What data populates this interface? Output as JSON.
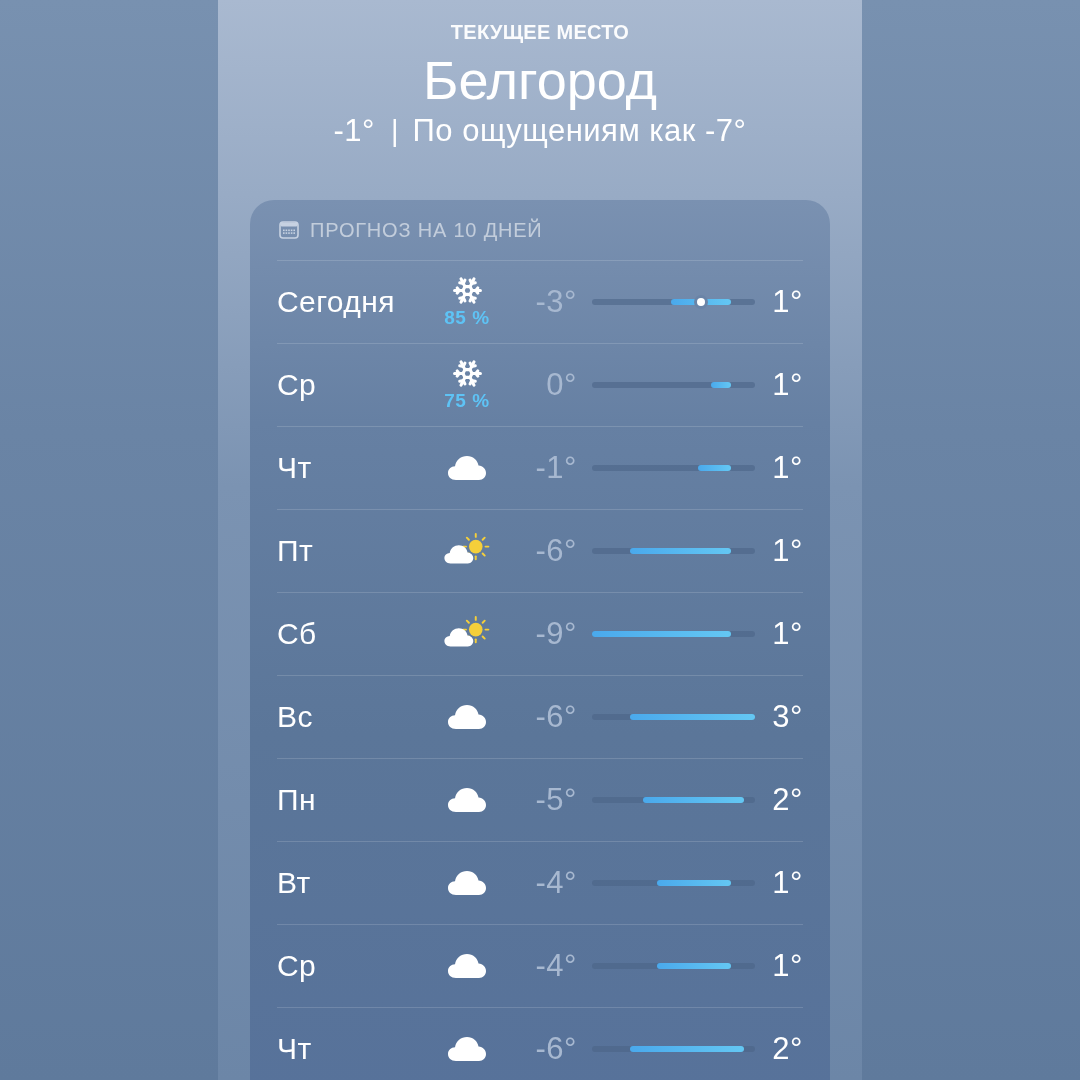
{
  "header": {
    "subtitle": "ТЕКУЩЕЕ МЕСТО",
    "city": "Белгород",
    "temperature": "-1°",
    "separator": "|",
    "feels_like": "По ощущениям как -7°"
  },
  "forecast": {
    "title": "ПРОГНОЗ НА 10 ДНЕЙ",
    "days": [
      {
        "day": "Сегодня",
        "kind": "snow",
        "precipitation": "85 %",
        "low": "-3°",
        "high": "1°",
        "current": {
          "level": 0.67
        }
      },
      {
        "day": "Ср",
        "kind": "snow",
        "precipitation": "75 %",
        "low": "0°",
        "high": "1°"
      },
      {
        "day": "Чт",
        "kind": "cloudy",
        "low": "-1°",
        "high": "1°"
      },
      {
        "day": "Пт",
        "kind": "partly_sunny",
        "low": "-6°",
        "high": "1°"
      },
      {
        "day": "Сб",
        "kind": "partly_sunny",
        "low": "-9°",
        "high": "1°"
      },
      {
        "day": "Вс",
        "kind": "cloudy",
        "low": "-6°",
        "high": "3°"
      },
      {
        "day": "Пн",
        "kind": "cloudy",
        "low": "-5°",
        "high": "2°"
      },
      {
        "day": "Вт",
        "kind": "cloudy",
        "low": "-4°",
        "high": "1°"
      },
      {
        "day": "Ср",
        "kind": "cloudy",
        "low": "-4°",
        "high": "1°"
      },
      {
        "day": "Чт",
        "kind": "cloudy",
        "low": "-6°",
        "high": "2°"
      }
    ]
  }
}
